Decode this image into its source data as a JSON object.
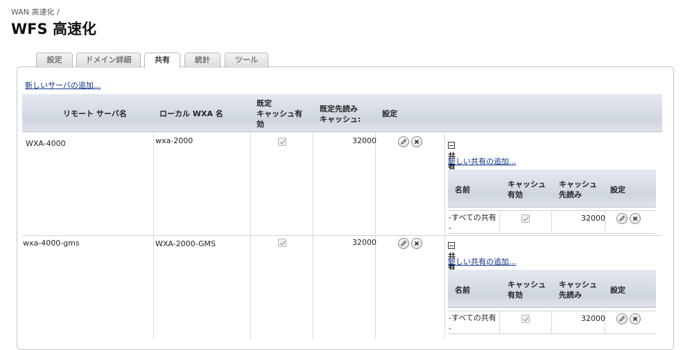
{
  "breadcrumb": "WAN 高速化 /",
  "page_title": "WFS 高速化",
  "tabs": [
    {
      "label": "設定",
      "active": false
    },
    {
      "label": "ドメイン詳細",
      "active": false
    },
    {
      "label": "共有",
      "active": true
    },
    {
      "label": "統計",
      "active": false
    },
    {
      "label": "ツール",
      "active": false
    }
  ],
  "add_server_link": "新しいサーバの追加...",
  "columns": {
    "remote": "リモート サーバ名",
    "local": "ローカル WXA 名",
    "cache_enabled": "既定\nキャッシュ有\n効",
    "prefetch": "既定先読み\nキャッシュ:",
    "settings": "設定"
  },
  "servers": [
    {
      "remote": "WXA-4000",
      "local": "wxa-2000",
      "cache_enabled": true,
      "prefetch": "32000",
      "shares": {
        "title": "共有",
        "add_link": "新しい共有の追加...",
        "columns": {
          "name": "名前",
          "cache": "キャッシュ\n有効",
          "prefetch": "キャッシュ\n先読み",
          "settings": "設定"
        },
        "rows": [
          {
            "name": "-すべての共有\n-",
            "cache": true,
            "prefetch": "32000"
          }
        ]
      }
    },
    {
      "remote": "wxa-4000-gms",
      "local": "WXA-2000-GMS",
      "cache_enabled": true,
      "prefetch": "32000",
      "shares": {
        "title": "共有",
        "add_link": "新しい共有の追加...",
        "columns": {
          "name": "名前",
          "cache": "キャッシュ\n有効",
          "prefetch": "キャッシュ\n先読み",
          "settings": "設定"
        },
        "rows": [
          {
            "name": "-すべての共有\n-",
            "cache": true,
            "prefetch": "32000"
          }
        ]
      }
    }
  ],
  "icons": {
    "edit": "pencil-icon",
    "delete": "x-icon",
    "collapse": "minus-box-icon",
    "checkbox": "checkmark-icon"
  }
}
